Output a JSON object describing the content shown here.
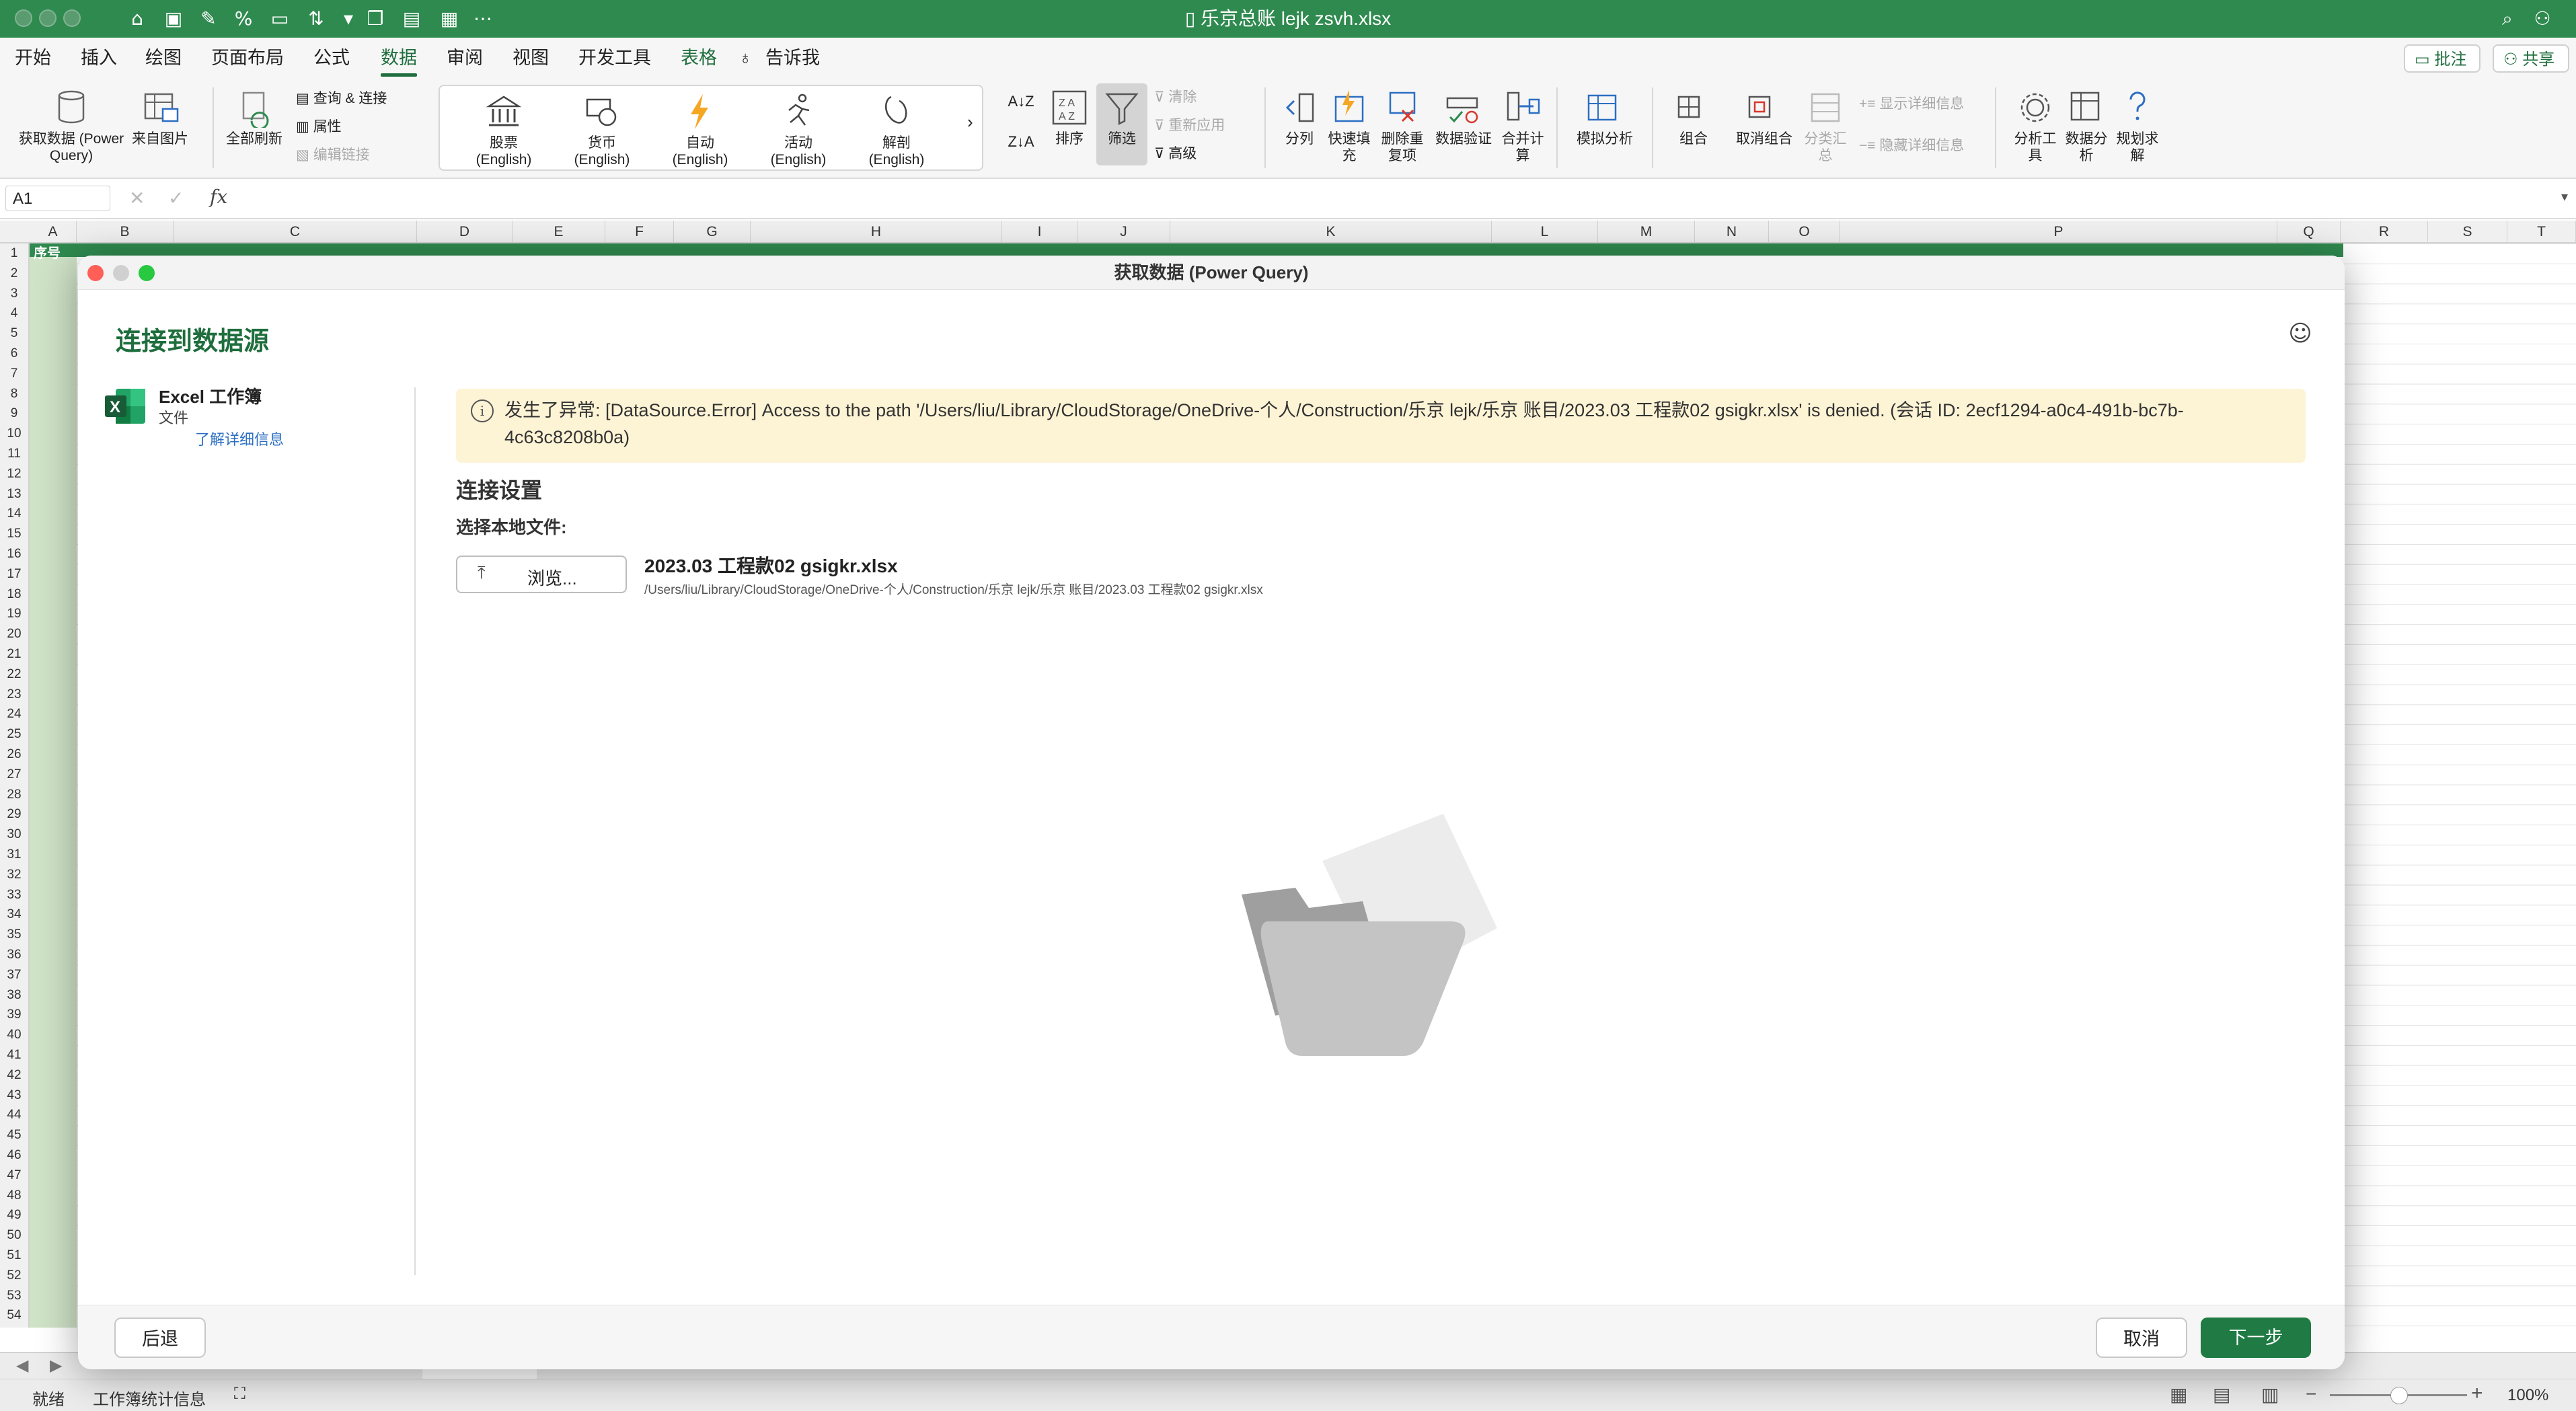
{
  "window": {
    "title": "乐京总账 lejk zsvh.xlsx"
  },
  "menu": {
    "tabs": [
      "开始",
      "插入",
      "绘图",
      "页面布局",
      "公式",
      "数据",
      "审阅",
      "视图",
      "开发工具",
      "表格"
    ],
    "tell_me": "告诉我",
    "comments": "批注",
    "share": "共享"
  },
  "ribbon": {
    "get_data": "获取数据 (Power Query)",
    "from_picture": "来自图片",
    "refresh_all": "全部刷新",
    "queries_connections": "查询 & 连接",
    "properties": "属性",
    "edit_links": "编辑链接",
    "data_types": [
      "股票 (English)",
      "货币 (English)",
      "自动 (English)",
      "活动 (English)",
      "解剖 (English)"
    ],
    "sort": "排序",
    "filter": "筛选",
    "clear": "清除",
    "reapply": "重新应用",
    "advanced": "高级",
    "text_to_columns": "分列",
    "flash_fill": "快速填充",
    "remove_duplicates": "删除重复项",
    "data_validation": "数据验证",
    "consolidate": "合并计算",
    "what_if": "模拟分析",
    "group": "组合",
    "ungroup": "取消组合",
    "subtotal": "分类汇总",
    "show_detail": "显示详细信息",
    "hide_detail": "隐藏详细信息",
    "analysis_tools": "分析工具",
    "data_analysis": "数据分析",
    "solver": "规划求解"
  },
  "formula_bar": {
    "name_box": "A1",
    "fx": "fx"
  },
  "grid": {
    "columns": [
      "A",
      "B",
      "C",
      "D",
      "E",
      "F",
      "G",
      "H",
      "I",
      "J",
      "K",
      "L",
      "M",
      "N",
      "O",
      "P",
      "Q",
      "R",
      "S",
      "T"
    ],
    "row_count": 54,
    "a1_value": "序号"
  },
  "dialog": {
    "title": "获取数据 (Power Query)",
    "heading": "连接到数据源",
    "source": {
      "name": "Excel 工作簿",
      "type": "文件",
      "learn_more": "了解详细信息"
    },
    "error": "发生了异常: [DataSource.Error] Access to the path '/Users/liu/Library/CloudStorage/OneDrive-个人/Construction/乐京 lejk/乐京 账目/2023.03 工程款02 gsigkr.xlsx' is denied. (会话 ID: 2ecf1294-a0c4-491b-bc7b-4c63c8208b0a)",
    "connection_settings": "连接设置",
    "select_local_file": "选择本地文件:",
    "browse": "浏览...",
    "file_name": "2023.03 工程款02 gsigkr.xlsx",
    "file_path": "/Users/liu/Library/CloudStorage/OneDrive-个人/Construction/乐京 lejk/乐京 账目/2023.03 工程款02 gsigkr.xlsx",
    "back": "后退",
    "cancel": "取消",
    "next": "下一步"
  },
  "status": {
    "ready": "就绪",
    "workbook_stats": "工作簿统计信息",
    "zoom": "100%"
  },
  "colors": {
    "excel_green": "#2f8a4f",
    "accent_green": "#1f6e3d",
    "error_bg": "#fdf3d5"
  }
}
